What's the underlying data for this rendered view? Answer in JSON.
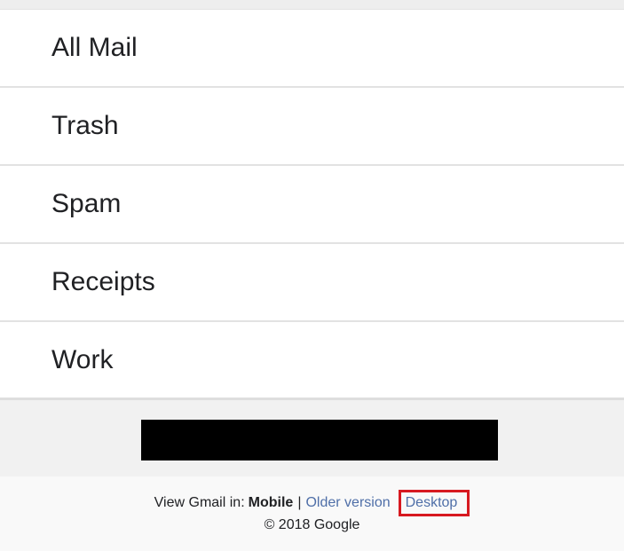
{
  "menu": {
    "items": [
      {
        "label": "All Mail"
      },
      {
        "label": "Trash"
      },
      {
        "label": "Spam"
      },
      {
        "label": "Receipts"
      },
      {
        "label": "Work"
      }
    ]
  },
  "footer": {
    "view_in_label": "View Gmail in:",
    "mobile_label": "Mobile",
    "separator": "|",
    "older_version_label": "Older version",
    "desktop_label": "Desktop",
    "copyright": "© 2018 Google"
  },
  "colors": {
    "link": "#4f6fa8",
    "highlight_box": "#d71920",
    "redaction": "#000000"
  }
}
